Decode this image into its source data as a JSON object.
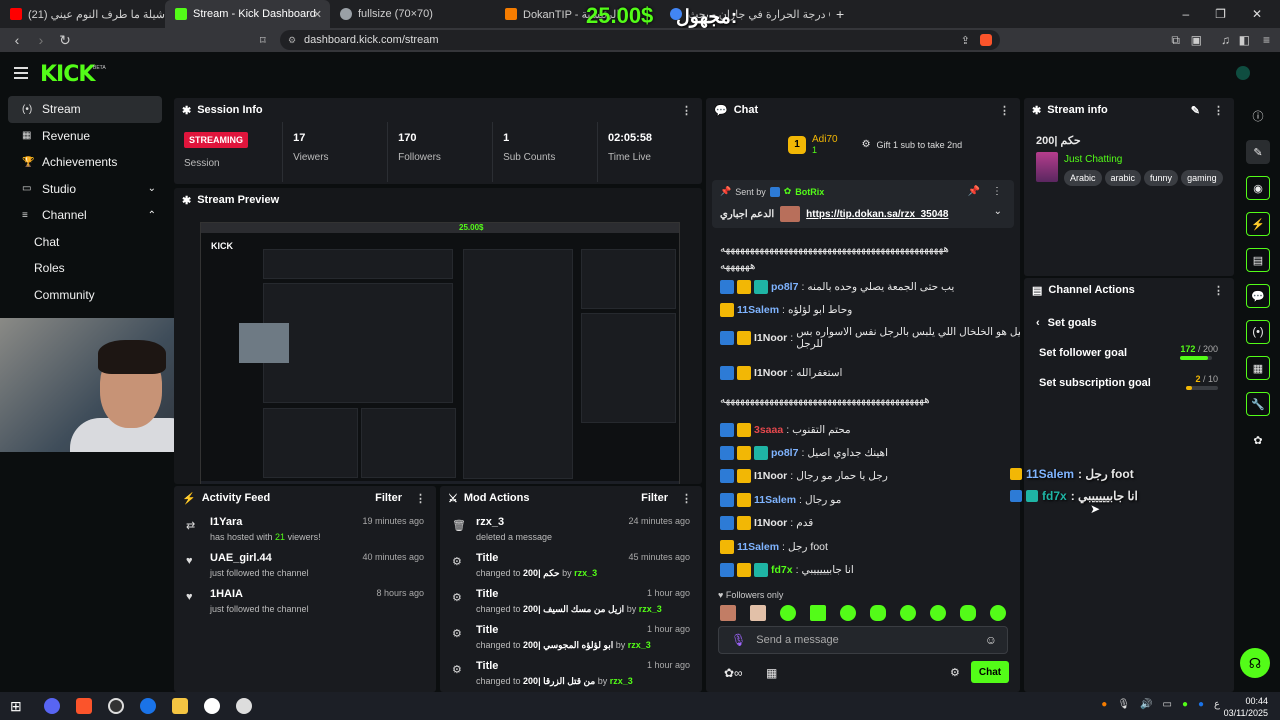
{
  "browser": {
    "tabs": [
      {
        "label": "(21) شيلة ما طرف النوم عيني - YouTube",
        "favicon_color": "#ff0000"
      },
      {
        "label": "Stream - Kick Dashboard",
        "favicon_color": "#53fc18",
        "active": true
      },
      {
        "label": "fullsize (70×70)",
        "favicon_color": "#9aa0a6"
      },
      {
        "label": "DokanTIP - الرئيسية",
        "favicon_color": "#f57c00"
      },
      {
        "label": "درجة الحرارة في جازان - بحث Google",
        "favicon_color": "#4285f4"
      }
    ],
    "new_tab": "+",
    "window_controls": [
      "–",
      "❐",
      "✕"
    ],
    "url": "dashboard.kick.com/stream",
    "overlay_amount": "25.00$",
    "overlay_name": "مجهول:"
  },
  "nav": {
    "logo": "KICK",
    "beta": "BETA"
  },
  "sidebar": {
    "items": [
      {
        "label": "Stream",
        "icon": "(•)",
        "active": true
      },
      {
        "label": "Revenue",
        "icon": "▦"
      },
      {
        "label": "Achievements",
        "icon": "🏆"
      },
      {
        "label": "Studio",
        "icon": "▭",
        "chevron": "⌄"
      },
      {
        "label": "Channel",
        "icon": "≡",
        "chevron": "⌃"
      }
    ],
    "subitems": [
      "Chat",
      "Roles",
      "Community"
    ]
  },
  "session_info": {
    "title": "Session Info",
    "live_badge": "STREAMING",
    "session_label": "Session",
    "stats": [
      {
        "value": "17",
        "label": "Viewers"
      },
      {
        "value": "170",
        "label": "Followers"
      },
      {
        "value": "1",
        "label": "Sub Counts"
      },
      {
        "value": "02:05:58",
        "label": "Time Live"
      }
    ]
  },
  "preview": {
    "title": "Stream Preview",
    "mini_money": "25.00$"
  },
  "activity": {
    "title": "Activity Feed",
    "filter": "Filter",
    "items": [
      {
        "name": "I1Yara",
        "desc_pre": "has hosted with ",
        "desc_hl": "21",
        "desc_post": " viewers!",
        "time": "19 minutes ago",
        "icon": "⇄"
      },
      {
        "name": "UAE_girl.44",
        "desc": "just followed the channel",
        "time": "40 minutes ago",
        "icon": "♥"
      },
      {
        "name": "1HAIA",
        "desc": "just followed the channel",
        "time": "8 hours ago",
        "icon": "♥"
      }
    ]
  },
  "mod_actions": {
    "title": "Mod Actions",
    "filter": "Filter",
    "items": [
      {
        "name": "rzx_3",
        "desc": "deleted a message",
        "time": "24 minutes ago",
        "icon": "🗑"
      },
      {
        "name": "Title",
        "desc_pre": "changed to ",
        "desc_hl": "200| حكم",
        "desc_mid": " by ",
        "by": "rzx_3",
        "time": "45 minutes ago",
        "icon": "⚙"
      },
      {
        "name": "Title",
        "desc_pre": "changed to ",
        "desc_hl": "200| ازيل من مسك السيف",
        "desc_mid": " by ",
        "by": "rzx_3",
        "time": "1 hour ago",
        "icon": "⚙"
      },
      {
        "name": "Title",
        "desc_pre": "changed to ",
        "desc_hl": "200| ابو لؤلؤه المجوسي",
        "desc_mid": " by ",
        "by": "rzx_3",
        "time": "1 hour ago",
        "icon": "⚙"
      },
      {
        "name": "Title",
        "desc_pre": "changed to ",
        "desc_hl": "200| من قتل الزرقا",
        "desc_mid": " by ",
        "by": "rzx_3",
        "time": "1 hour ago",
        "icon": "⚙"
      }
    ]
  },
  "chat": {
    "title": "Chat",
    "top_gifter": {
      "name": "Adi70",
      "count": "1",
      "rank": "1"
    },
    "gift_prompt": "Gift 1 sub to take 2nd",
    "pinned": {
      "sent_by_label": "Sent by",
      "bot": "BotRix",
      "label": "الدعم اجباري",
      "link": "https://tip.dokan.sa/rzx_35048"
    },
    "messages": [
      {
        "user": "",
        "text": "ههههههههههههههههههههههههههههههههههههههههههههههه",
        "color": "#fff"
      },
      {
        "user": "",
        "text": "ههههههه",
        "color": "#fff"
      },
      {
        "user": "po8l7",
        "text": "يب حتى الجمعة يصلي وحده بالمنه",
        "color": "#7fb4ff",
        "badges": [
          "blue",
          "gold",
          "teal"
        ]
      },
      {
        "user": "11Salem",
        "text": "وحاط ابو لؤلؤه",
        "color": "#7fb4ff",
        "badges": [
          "gold"
        ]
      },
      {
        "user": "I1Noor",
        "text": "الحيل هو الخلخال اللي يلبس بالرجل نفس الاسواره بس للرجل",
        "color": "#f2f2f2",
        "badges": [
          "blue",
          "gold"
        ]
      },
      {
        "user": "I1Noor",
        "text": "استغفرالله",
        "color": "#f2f2f2",
        "badges": [
          "blue",
          "gold"
        ]
      },
      {
        "user": "",
        "text": "ههههههههههههههههههههههههههههههههههههههههههه",
        "color": "#fff"
      },
      {
        "user": "3saaa",
        "text": "محتم التقنوب",
        "color": "#e5484d",
        "badges": [
          "blue",
          "gold"
        ]
      },
      {
        "user": "po8l7",
        "text": "اهينك جداوي اصيل",
        "color": "#7fb4ff",
        "badges": [
          "blue",
          "gold",
          "teal"
        ]
      },
      {
        "user": "I1Noor",
        "text": "رجل يا حمار مو رجال",
        "color": "#f2f2f2",
        "badges": [
          "blue",
          "gold"
        ]
      },
      {
        "user": "11Salem",
        "text": "مو رجال",
        "color": "#7fb4ff",
        "badges": [
          "blue",
          "gold"
        ]
      },
      {
        "user": "I1Noor",
        "text": "قدم",
        "color": "#f2f2f2",
        "badges": [
          "blue",
          "gold"
        ]
      },
      {
        "user": "11Salem",
        "text": "رجل foot",
        "color": "#7fb4ff",
        "badges": [
          "gold"
        ]
      },
      {
        "user": "fd7x",
        "text": "انا جابيييييبي",
        "color": "#53fc18",
        "badges": [
          "blue",
          "gold",
          "teal"
        ]
      }
    ],
    "followers_only": "Followers only",
    "input_placeholder": "Send a message",
    "send": "Chat"
  },
  "stream_info": {
    "title": "Stream info",
    "stream_title": "حكم |200",
    "category": "Just Chatting",
    "tags": [
      "Arabic",
      "arabic",
      "funny",
      "gaming"
    ]
  },
  "channel_actions": {
    "title": "Channel Actions",
    "back_label": "Set goals",
    "goals": [
      {
        "label": "Set follower goal",
        "current": "172",
        "target": "/ 200",
        "fraction": 0.86,
        "color": "#53fc18"
      },
      {
        "label": "Set subscription goal",
        "current": "2",
        "target": "/ 10",
        "fraction": 0.2,
        "color": "#f2b705"
      }
    ]
  },
  "overlay_chat": [
    {
      "user": "11Salem",
      "text": ": رجل foot"
    },
    {
      "user": "fd7x",
      "text": ": انا جابيييييبي"
    }
  ],
  "taskbar": {
    "time": "00:44",
    "date": "03/11/2025",
    "lang": "ع"
  }
}
